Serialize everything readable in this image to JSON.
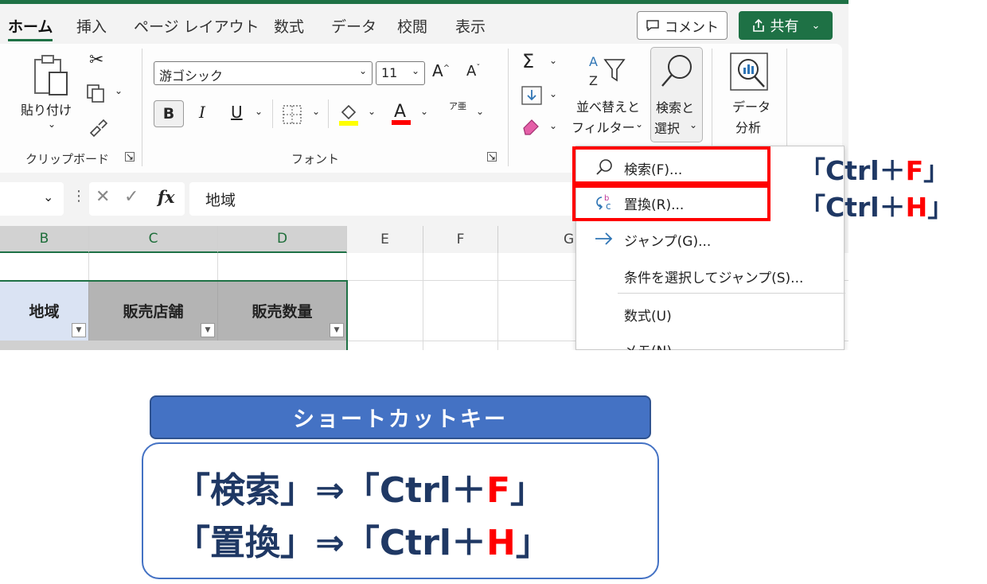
{
  "ribbon_tabs": [
    "ホーム",
    "挿入",
    "ページ レイアウト",
    "数式",
    "データ",
    "校閲",
    "表示"
  ],
  "comment_label": "コメント",
  "share_label": "共有",
  "clipboard": {
    "paste_label": "貼り付け",
    "group_label": "クリップボード"
  },
  "font": {
    "font_name": "游ゴシック",
    "font_size": "11",
    "group_label": "フォント",
    "bold": "B",
    "italic": "I",
    "underline": "U",
    "phonetic": "ア亜"
  },
  "editing": {
    "sort_label1": "並べ替えと",
    "sort_label2": "フィルター",
    "find_label1": "検索と",
    "find_label2": "選択"
  },
  "analyze": {
    "label1": "データ",
    "label2": "分析"
  },
  "formula_bar": {
    "fx": "fx",
    "content": "地域"
  },
  "columns": [
    "B",
    "C",
    "D",
    "E",
    "F",
    "G"
  ],
  "table_headers": [
    "地域",
    "販売店舗",
    "販売数量"
  ],
  "dropdown_menu": [
    "検索(F)...",
    "置換(R)...",
    "ジャンプ(G)...",
    "条件を選択してジャンプ(S)...",
    "数式(U)",
    "メモ(N)"
  ],
  "shortcut_callouts": [
    {
      "prefix": "「Ctrl＋",
      "key": "F",
      "suffix": "」"
    },
    {
      "prefix": "「Ctrl＋",
      "key": "H",
      "suffix": "」"
    }
  ],
  "card": {
    "title": "ショートカットキー",
    "lines": [
      {
        "prefix": "「検索」⇒「Ctrl＋",
        "key": "F",
        "suffix": "」"
      },
      {
        "prefix": "「置換」⇒「Ctrl＋",
        "key": "H",
        "suffix": "」"
      }
    ]
  },
  "colors": {
    "excel_green": "#1e7145",
    "highlight_red": "#ff0000",
    "card_blue": "#4472c4",
    "text_navy": "#1f3864"
  }
}
